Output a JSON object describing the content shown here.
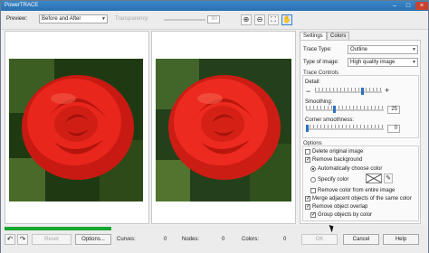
{
  "window": {
    "title": "PowerTRACE",
    "minimize_glyph": "–",
    "maximize_glyph": "□",
    "close_glyph": "×"
  },
  "toolbar": {
    "preview_label": "Preview:",
    "preview_value": "Before and After",
    "transparency_label": "Transparency",
    "transparency_value": "80",
    "zoom_in_icon": "zoom-in-icon",
    "zoom_out_icon": "zoom-out-icon",
    "fit_icon": "fit-to-window-icon",
    "pan_icon": "pan-icon",
    "zoom_in_glyph": "⊕",
    "zoom_out_glyph": "⊖",
    "fit_glyph": "⛶",
    "pan_glyph": "✋"
  },
  "tabs": [
    {
      "label": "Settings",
      "active": true
    },
    {
      "label": "Colors",
      "active": false
    }
  ],
  "settings": {
    "trace_type_label": "Trace Type:",
    "trace_type_value": "Outline",
    "image_type_label": "Type of image:",
    "image_type_value": "High quality image",
    "trace_controls_title": "Trace Controls",
    "detail_label": "Detail:",
    "detail_minus": "−",
    "detail_plus": "+",
    "detail_level": 0.72,
    "smoothing_label": "Smoothing:",
    "smoothing_value": "25",
    "corner_label": "Corner smoothness:",
    "corner_value": "0",
    "options_title": "Options",
    "delete_original": {
      "label": "Delete original image",
      "checked": false
    },
    "remove_background": {
      "label": "Remove background",
      "checked": true
    },
    "auto_color": {
      "label": "Automatically choose color",
      "selected": true
    },
    "specify_color": {
      "label": "Specify color",
      "selected": false
    },
    "remove_entire": {
      "label": "Remove color from entire image",
      "checked": false
    },
    "merge_adjacent": {
      "label": "Merge adjacent objects of the same color",
      "checked": true
    },
    "remove_overlap": {
      "label": "Remove object overlap",
      "checked": true
    },
    "group_by_color": {
      "label": "Group objects by color",
      "checked": true
    },
    "check_glyph": "✓"
  },
  "status": {
    "progress": 1.0,
    "reset_label": "Reset",
    "options_label": "Options...",
    "curves_label": "Curves:",
    "curves_value": "0",
    "nodes_label": "Nodes:",
    "nodes_value": "0",
    "colors_label": "Colors:",
    "colors_value": "0"
  },
  "buttons": {
    "ok": "OK",
    "cancel": "Cancel",
    "help": "Help"
  },
  "colors": {
    "accent": "#2f6fbf",
    "progress": "#17a62e",
    "rose": "#e8261c"
  }
}
